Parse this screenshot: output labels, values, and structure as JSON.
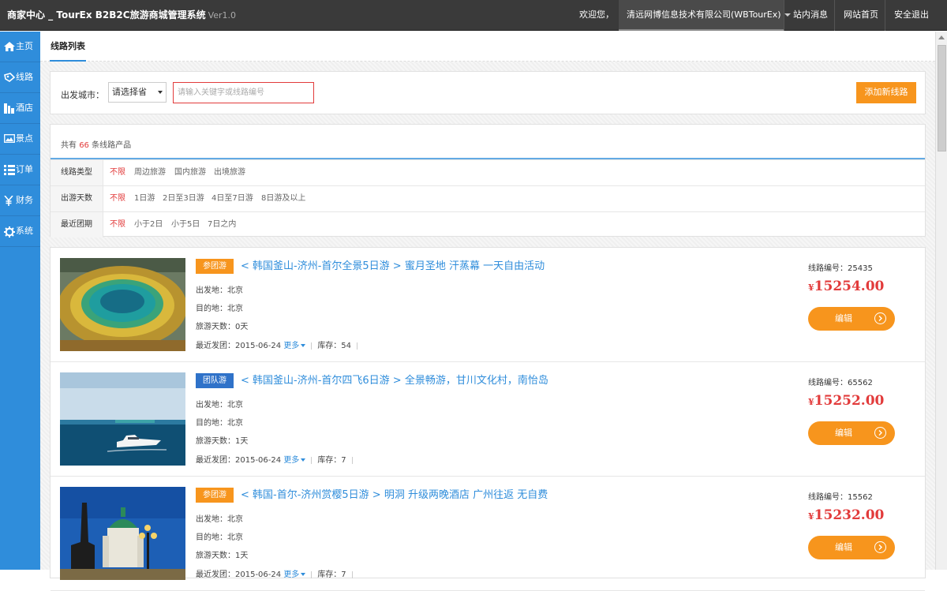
{
  "topbar": {
    "brand": "商家中心 _ TourEx B2B2C旅游商城管理系统",
    "version": "Ver1.0",
    "welcome": "欢迎您，",
    "company": "清远网博信息技术有限公司(WBTourEx)",
    "messages": "站内消息",
    "home": "网站首页",
    "logout": "安全退出"
  },
  "sidebar": {
    "items": [
      {
        "label": "主页",
        "icon": "home-icon"
      },
      {
        "label": "线路",
        "icon": "route-icon"
      },
      {
        "label": "酒店",
        "icon": "hotel-icon"
      },
      {
        "label": "景点",
        "icon": "picture-icon"
      },
      {
        "label": "订单",
        "icon": "list-icon"
      },
      {
        "label": "财务",
        "icon": "yen-icon"
      },
      {
        "label": "系统",
        "icon": "gear-icon"
      }
    ]
  },
  "tab": {
    "label": "线路列表"
  },
  "search": {
    "city_label": "出发城市：",
    "province_select": "请选择省",
    "keyword_placeholder": "请输入关键字或线路编号",
    "add_button": "添加新线路"
  },
  "summary": {
    "prefix": "共有",
    "count": "66",
    "suffix": "条线路产品"
  },
  "filters": [
    {
      "name": "线路类型",
      "options": [
        "不限",
        "周边旅游",
        "国内旅游",
        "出境旅游"
      ]
    },
    {
      "name": "出游天数",
      "options": [
        "不限",
        "1日游",
        "2日至3日游",
        "4日至7日游",
        "8日游及以上"
      ]
    },
    {
      "name": "最近团期",
      "options": [
        "不限",
        "小于2日",
        "小于5日",
        "7日之内"
      ]
    }
  ],
  "routes": [
    {
      "badge": "参团游",
      "badge_color": "#f7951d",
      "title": "< 韩国釜山-济州-首尔全景5日游 > 蜜月圣地 汗蒸幕 一天自由活动",
      "depart": "出发地：北京",
      "dest": "目的地：北京",
      "days": "旅游天数：0天",
      "recent": "最近发团：2015-06-24",
      "more": "更多",
      "stock": "库存：54",
      "code": "线路编号：25435",
      "currency": "¥",
      "price": "15254.00",
      "edit": "编辑"
    },
    {
      "badge": "团队游",
      "badge_color": "#2f72c9",
      "title": "< 韩国釜山-济州-首尔四飞6日游 > 全景畅游，甘川文化村，南怡岛",
      "depart": "出发地：北京",
      "dest": "目的地：北京",
      "days": "旅游天数：1天",
      "recent": "最近发团：2015-06-24",
      "more": "更多",
      "stock": "库存：7",
      "code": "线路编号：65562",
      "currency": "¥",
      "price": "15252.00",
      "edit": "编辑"
    },
    {
      "badge": "参团游",
      "badge_color": "#f7951d",
      "title": "< 韩国-首尔-济州赏樱5日游 > 明洞 升级两晚酒店 广州往返 无自费",
      "depart": "出发地：北京",
      "dest": "目的地：北京",
      "days": "旅游天数：1天",
      "recent": "最近发团：2015-06-24",
      "more": "更多",
      "stock": "库存：7",
      "code": "线路编号：15562",
      "currency": "¥",
      "price": "15232.00",
      "edit": "编辑"
    }
  ]
}
